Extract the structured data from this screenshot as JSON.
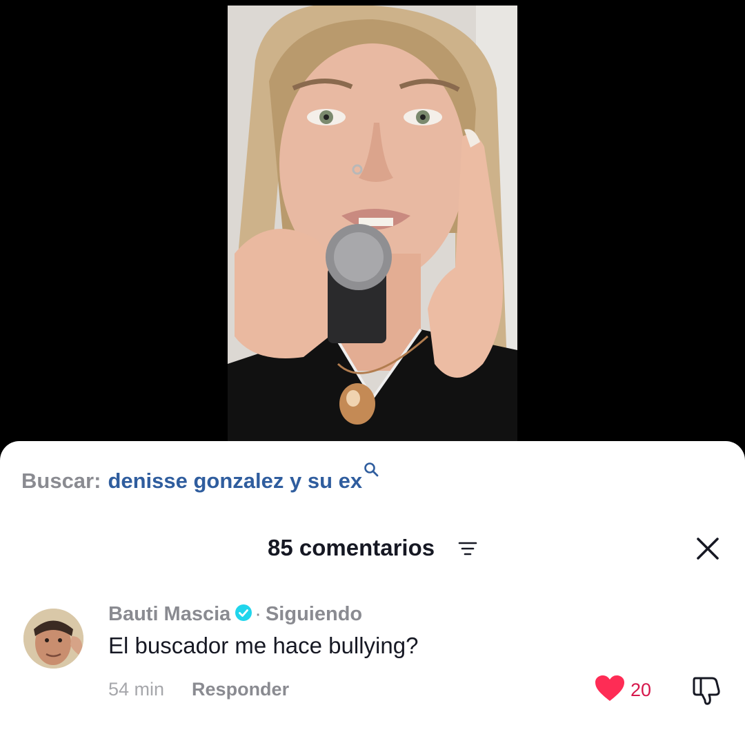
{
  "search": {
    "prefix": "Buscar:",
    "query": "denisse gonzalez y su ex"
  },
  "comments_header": {
    "count_label": "85 comentarios"
  },
  "comment": {
    "author": "Bauti Mascia",
    "separator": "·",
    "follow_status": "Siguiendo",
    "text": "El buscador me hace bullying?",
    "time_ago": "54 min",
    "reply_label": "Responder",
    "like_count": "20",
    "liked": true
  },
  "icons": {
    "search": "search-icon",
    "filter": "filter-icon",
    "close": "close-icon",
    "verified": "verified-badge-icon",
    "like": "heart-icon",
    "dislike": "thumbs-down-icon"
  },
  "colors": {
    "search_query": "#2f5d9e",
    "like": "#fe2c55",
    "verified": "#20d5ec",
    "muted_text": "#8a8b91",
    "primary_text": "#161823"
  }
}
